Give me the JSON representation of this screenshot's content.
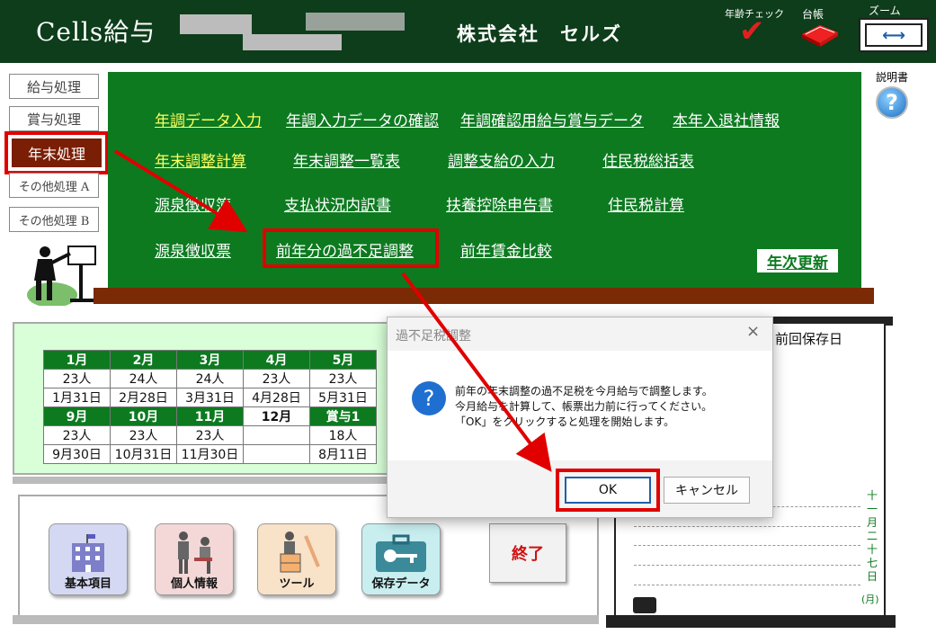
{
  "header": {
    "app_title": "Cells給与",
    "company": "株式会社　セルズ",
    "age_check_label": "年齢チェック",
    "ledger_label": "台帳",
    "zoom_label": "ズーム",
    "zoom_symbol": "⟷"
  },
  "nav": {
    "items": [
      {
        "label": "給与処理"
      },
      {
        "label": "賞与処理"
      },
      {
        "label": "年末処理"
      },
      {
        "label": "その他処理 A"
      },
      {
        "label": "その他処理 B"
      }
    ]
  },
  "menu": {
    "links": [
      {
        "label": "年調データ入力"
      },
      {
        "label": "年調入力データの確認"
      },
      {
        "label": "年調確認用給与賞与データ"
      },
      {
        "label": "本年入退社情報"
      },
      {
        "label": "年末調整計算"
      },
      {
        "label": "年末調整一覧表"
      },
      {
        "label": "調整支給の入力"
      },
      {
        "label": "住民税総括表"
      },
      {
        "label": "源泉徴収簿"
      },
      {
        "label": "支払状況内訳書"
      },
      {
        "label": "扶養控除申告書"
      },
      {
        "label": "住民税計算"
      },
      {
        "label": "源泉徴収票"
      },
      {
        "label": "前年分の過不足調整"
      },
      {
        "label": "前年賃金比較"
      }
    ],
    "annual_update": "年次更新"
  },
  "manual_label": "説明書",
  "help_glyph": "?",
  "calendar": {
    "row1": [
      {
        "month": "1月",
        "count": "23人",
        "date": "1月31日"
      },
      {
        "month": "2月",
        "count": "24人",
        "date": "2月28日"
      },
      {
        "month": "3月",
        "count": "24人",
        "date": "3月31日"
      },
      {
        "month": "4月",
        "count": "23人",
        "date": "4月28日"
      },
      {
        "month": "5月",
        "count": "23人",
        "date": "5月31日"
      }
    ],
    "row2": [
      {
        "month": "9月",
        "count": "23人",
        "date": "9月30日"
      },
      {
        "month": "10月",
        "count": "23人",
        "date": "10月31日"
      },
      {
        "month": "11月",
        "count": "23人",
        "date": "11月30日"
      },
      {
        "month": "12月",
        "count": "",
        "date": ""
      },
      {
        "month": "賞与1",
        "count": "18人",
        "date": "8月11日"
      }
    ]
  },
  "buttons": {
    "basic": "基本項目",
    "personal": "個人情報",
    "tools": "ツール",
    "save_data": "保存データ",
    "exit": "終了"
  },
  "notebook": {
    "prev_save": "前回保存日",
    "vertical_date": "十一月二十七日",
    "weekday": "(月)"
  },
  "dialog": {
    "title": "過不足税調整",
    "close_glyph": "×",
    "question_glyph": "?",
    "line1": "前年の年末調整の過不足税を今月給与で調整します。",
    "line2": "今月給与を計算して、帳票出力前に行ってください。",
    "line3": "「OK」をクリックすると処理を開始します。",
    "ok": "OK",
    "cancel": "キャンセル"
  },
  "colors": {
    "header_bg": "#0d3d1a",
    "menu_green": "#0d7a20",
    "highlight_red": "#e00000",
    "active_nav": "#7a1e05"
  }
}
